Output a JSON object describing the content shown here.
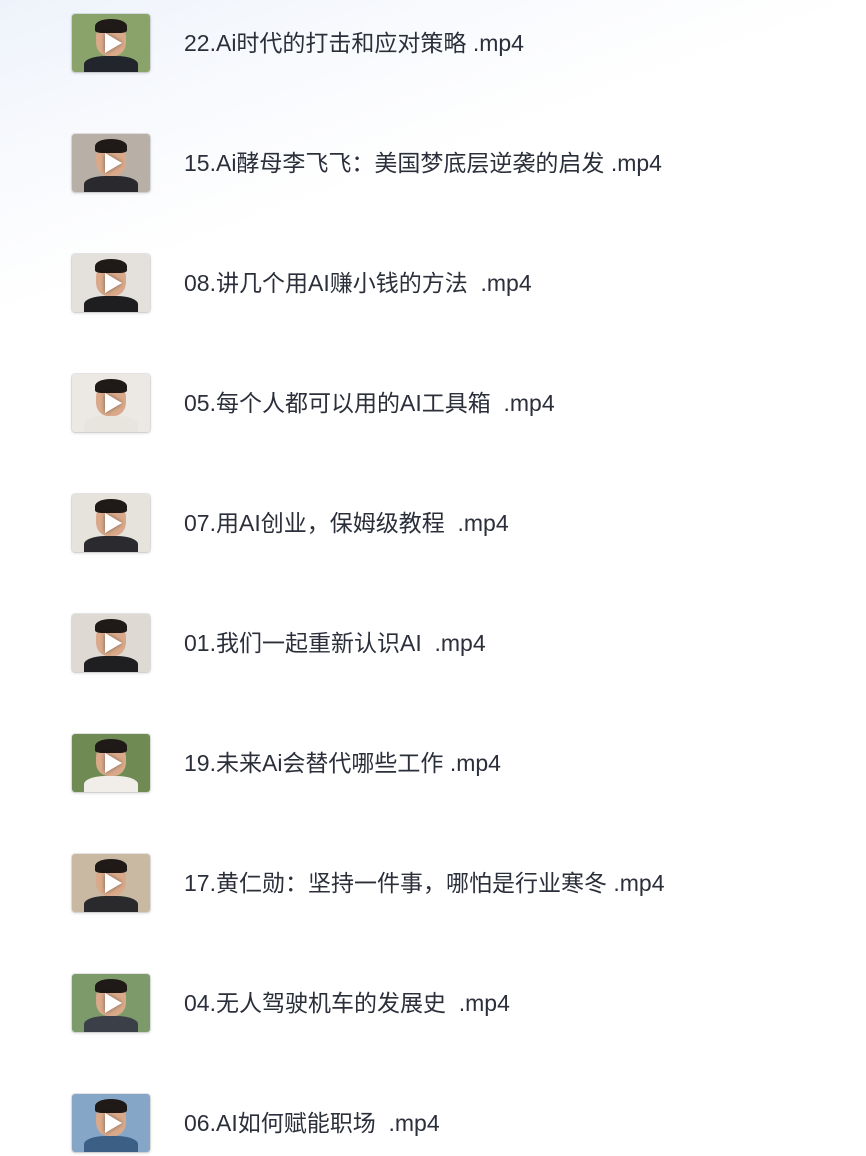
{
  "files": [
    {
      "name": "22.Ai时代的打击和应对策略 .mp4",
      "thumb_bg": "#8aa36a",
      "shirt": "#22262c",
      "icon": "play-icon"
    },
    {
      "name": "15.Ai酵母李飞飞：美国梦底层逆袭的启发 .mp4",
      "thumb_bg": "#b8b0a6",
      "shirt": "#2a2a2e",
      "icon": "play-icon"
    },
    {
      "name": "08.讲几个用AI赚小钱的方法  .mp4",
      "thumb_bg": "#e4e1dc",
      "shirt": "#1e1e20",
      "icon": "play-icon"
    },
    {
      "name": "05.每个人都可以用的AI工具箱  .mp4",
      "thumb_bg": "#ece9e4",
      "shirt": "#e8e4de",
      "icon": "play-icon"
    },
    {
      "name": "07.用AI创业，保姆级教程  .mp4",
      "thumb_bg": "#e6e2dc",
      "shirt": "#2b2b2f",
      "icon": "play-icon"
    },
    {
      "name": "01.我们一起重新认识AI  .mp4",
      "thumb_bg": "#dedad3",
      "shirt": "#1f1f22",
      "icon": "play-icon"
    },
    {
      "name": "19.未来Ai会替代哪些工作 .mp4",
      "thumb_bg": "#6f8a52",
      "shirt": "#f1eeea",
      "icon": "play-icon"
    },
    {
      "name": "17.黄仁勋：坚持一件事，哪怕是行业寒冬 .mp4",
      "thumb_bg": "#c9b9a2",
      "shirt": "#2a2a2c",
      "icon": "play-icon"
    },
    {
      "name": "04.无人驾驶机车的发展史  .mp4",
      "thumb_bg": "#7d9a6a",
      "shirt": "#3a3f48",
      "icon": "play-icon"
    },
    {
      "name": "06.AI如何赋能职场  .mp4",
      "thumb_bg": "#86a6c8",
      "shirt": "#3c5f86",
      "icon": "play-icon"
    }
  ]
}
